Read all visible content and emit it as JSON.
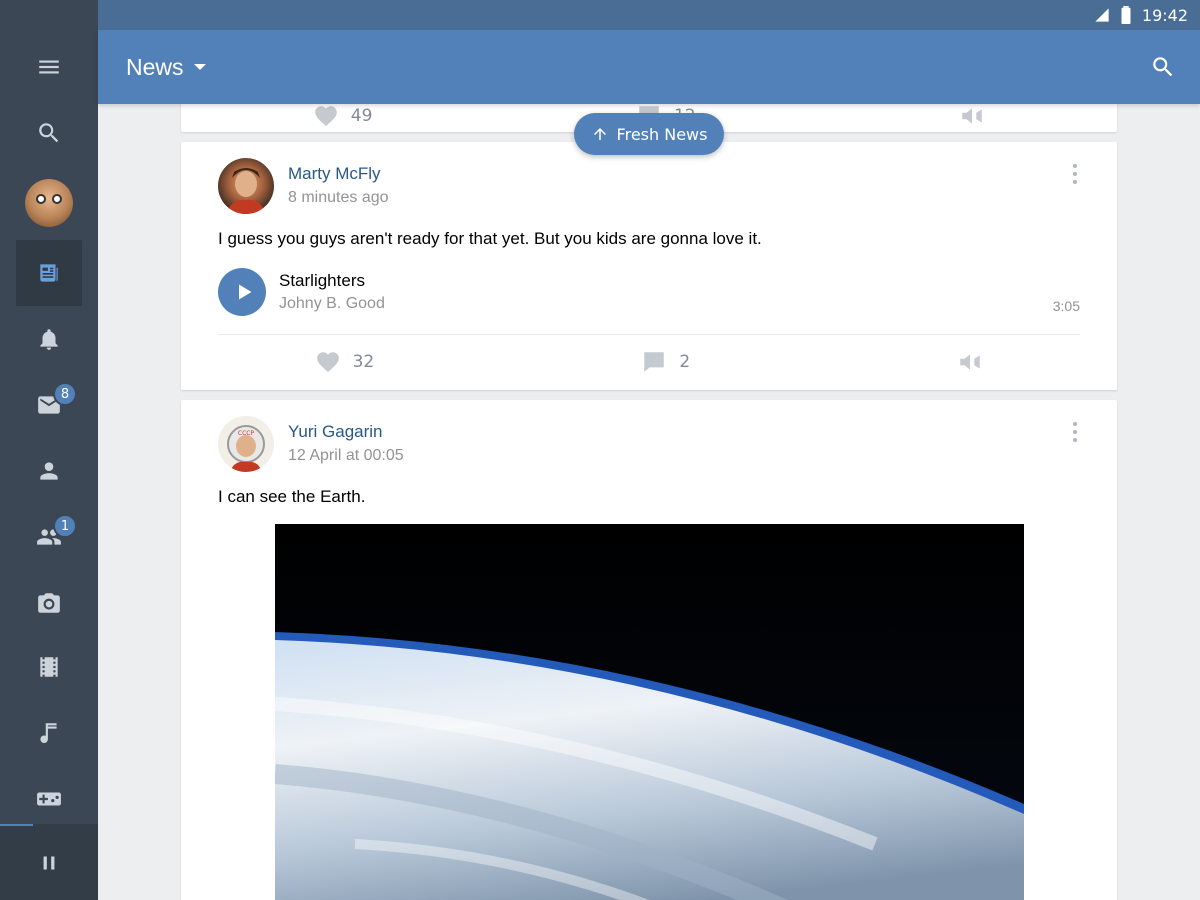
{
  "status_bar": {
    "time": "19:42"
  },
  "header": {
    "title": "News"
  },
  "sidebar": {
    "items": [
      {
        "name": "menu",
        "badge": ""
      },
      {
        "name": "search",
        "badge": ""
      },
      {
        "name": "profile",
        "badge": ""
      },
      {
        "name": "news",
        "badge": ""
      },
      {
        "name": "notifications",
        "badge": ""
      },
      {
        "name": "messages",
        "badge": "8"
      },
      {
        "name": "friends",
        "badge": ""
      },
      {
        "name": "groups",
        "badge": "1"
      },
      {
        "name": "photos",
        "badge": ""
      },
      {
        "name": "videos",
        "badge": ""
      },
      {
        "name": "music",
        "badge": ""
      },
      {
        "name": "games",
        "badge": ""
      }
    ],
    "player_control": "pause"
  },
  "fresh_news": {
    "label": "Fresh News"
  },
  "feed": {
    "previous_post": {
      "likes": "49",
      "comments": "12"
    },
    "posts": [
      {
        "author": "Marty McFly",
        "time": "8 minutes ago",
        "text": "I guess you guys aren't ready for that yet. But you kids are gonna love it.",
        "audio": {
          "title": "Starlighters",
          "artist": "Johny B. Good",
          "duration": "3:05"
        },
        "likes": "32",
        "comments": "2"
      },
      {
        "author": "Yuri Gagarin",
        "time": "12 April at 00:05",
        "text": "I can see the Earth."
      }
    ]
  },
  "colors": {
    "accent": "#5181b8",
    "sidebar": "#3b4754",
    "link": "#2a5885"
  }
}
